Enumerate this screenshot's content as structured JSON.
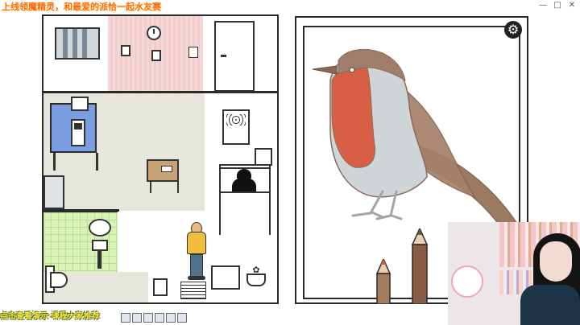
{
  "overlay": {
    "top_caption": "上线领魔精灵，和最爱的派恰一起水友赛",
    "bottom_caption": "点击查看演示·课程大家推荐"
  },
  "window_controls": [
    "minimize-icon",
    "restore-icon",
    "close-icon"
  ],
  "game": {
    "settings_icon": "gear-icon",
    "painting_subject": "robin",
    "pencil_colors": {
      "brown_light": "#a57b5e",
      "brown_dark": "#7a5340",
      "pencil_tip": "#d2623e"
    },
    "bird_colors": {
      "head": "#a07e6c",
      "breast": "#d65f45",
      "belly": "#cfd4d6",
      "wing": "#9c7b63",
      "outline": "#8a6a56"
    },
    "house_colors": {
      "pink_wall": "#f4d8d8",
      "floor": "#e6e6dd",
      "bathroom_tiles": "#d9f2b5",
      "blue_table": "#7a9ee0",
      "wood_table": "#c8a274",
      "person_shirt": "#f1be3b",
      "person_pants": "#52718d"
    }
  },
  "webcam": {
    "badge_text": ""
  },
  "taskbar": {
    "icons": [
      "app-icon-1",
      "app-icon-2",
      "app-icon-3",
      "app-icon-4",
      "app-icon-5",
      "app-icon-6"
    ]
  }
}
